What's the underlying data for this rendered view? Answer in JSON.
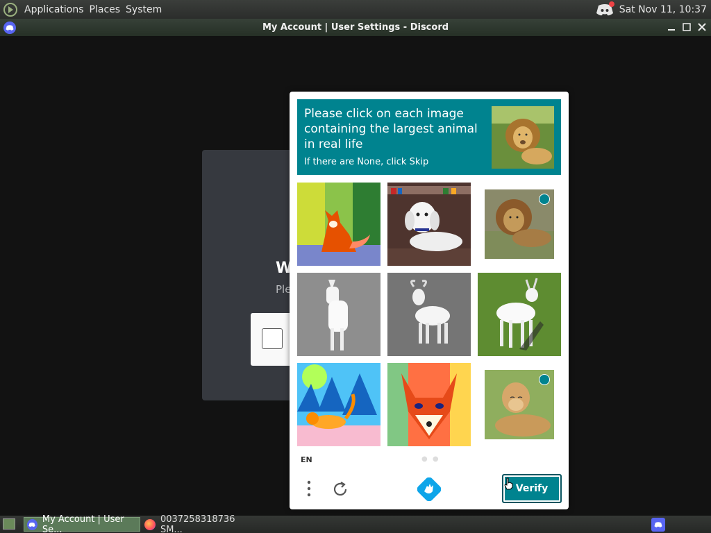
{
  "top_panel": {
    "menus": [
      "Applications",
      "Places",
      "System"
    ],
    "clock": "Sat Nov 11, 10:37"
  },
  "window": {
    "title": "My Account | User Settings - Discord"
  },
  "background_modal": {
    "heading_fragment": "W",
    "text_fragment": "Ple"
  },
  "challenge": {
    "prompt": "Please click on each image containing the largest animal in real life",
    "sub_prompt": "If there are None, click Skip",
    "tiles": [
      {
        "name": "fox-painting",
        "selected": false
      },
      {
        "name": "white-dog-figurine",
        "selected": false
      },
      {
        "name": "lion",
        "selected": true
      },
      {
        "name": "white-goat-sketch",
        "selected": false
      },
      {
        "name": "white-goat-model",
        "selected": false
      },
      {
        "name": "white-goat-on-grass",
        "selected": false
      },
      {
        "name": "cat-painting",
        "selected": false
      },
      {
        "name": "fox-face-painting",
        "selected": false
      },
      {
        "name": "lioness",
        "selected": true
      }
    ],
    "language": "EN",
    "verify_label": "Verify"
  },
  "taskbar": {
    "tasks": [
      "My Account | User Se...",
      "0037258318736 SM..."
    ]
  },
  "colors": {
    "accent": "#00838f",
    "discord": "#5865f2"
  }
}
